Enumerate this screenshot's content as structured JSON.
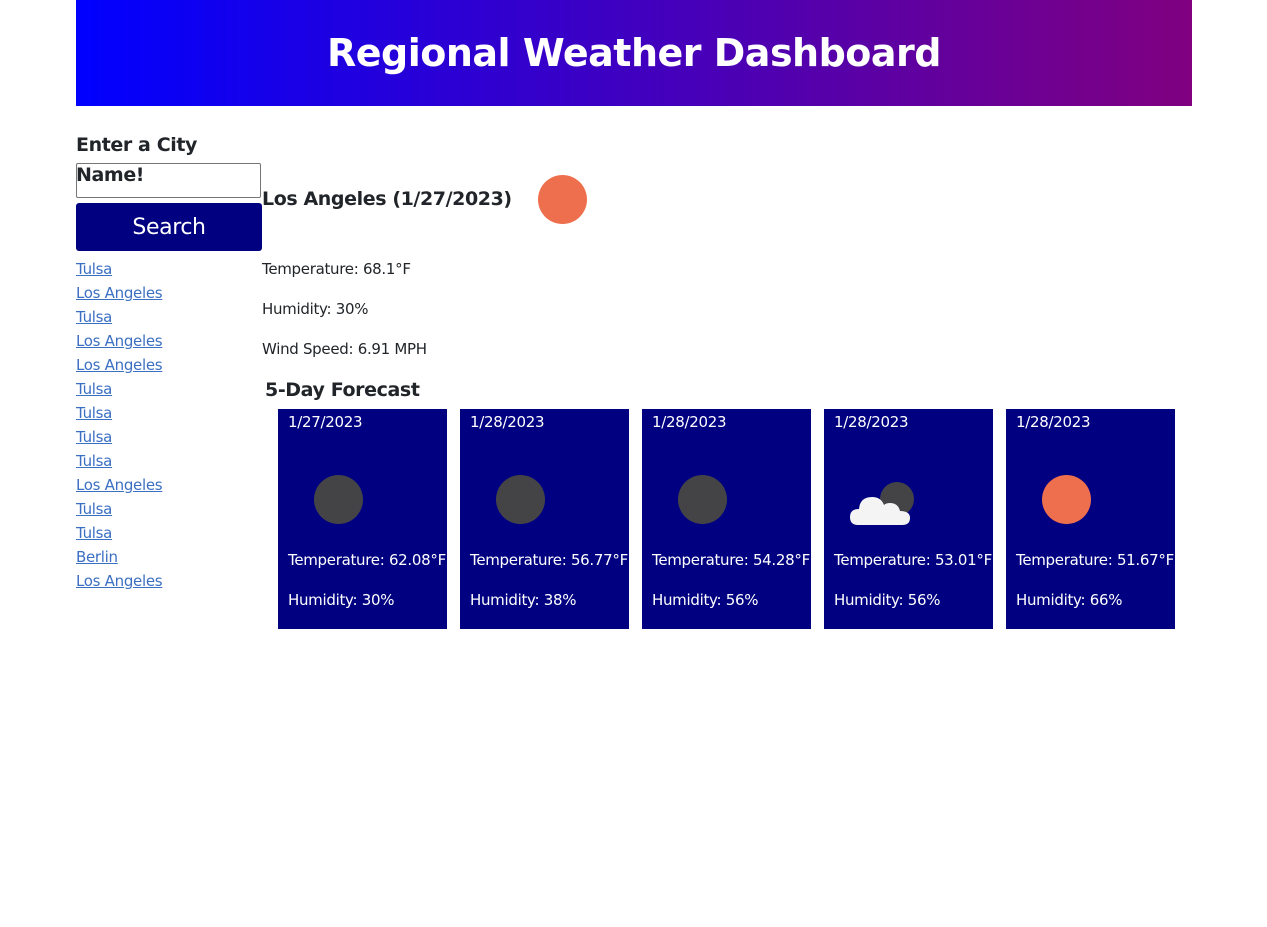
{
  "header": {
    "title": "Regional Weather Dashboard",
    "gradient_start": "#0000ff",
    "gradient_end": "#800080"
  },
  "search": {
    "label": "Enter a City Name!",
    "input_value": "",
    "button_label": "Search"
  },
  "history": [
    "Tulsa",
    "Los Angeles",
    "Tulsa",
    "Los Angeles",
    "Los Angeles",
    "Tulsa",
    "Tulsa",
    "Tulsa",
    "Tulsa",
    "Los Angeles",
    "Tulsa",
    "Tulsa",
    "Berlin",
    "Los Angeles"
  ],
  "current": {
    "title": "Los Angeles (1/27/2023)",
    "icon": "clear-day-icon",
    "temperature": "Temperature: 68.1°F",
    "humidity": "Humidity: 30%",
    "wind": "Wind Speed: 6.91 MPH"
  },
  "forecast": {
    "title": "5-Day Forecast",
    "card_color": "#000080",
    "days": [
      {
        "date": "1/27/2023",
        "icon": "clear-night-icon",
        "temperature": "Temperature: 62.08°F",
        "humidity": "Humidity: 30%"
      },
      {
        "date": "1/28/2023",
        "icon": "clear-night-icon",
        "temperature": "Temperature: 56.77°F",
        "humidity": "Humidity: 38%"
      },
      {
        "date": "1/28/2023",
        "icon": "clear-night-icon",
        "temperature": "Temperature: 54.28°F",
        "humidity": "Humidity: 56%"
      },
      {
        "date": "1/28/2023",
        "icon": "cloudy-night-icon",
        "temperature": "Temperature: 53.01°F",
        "humidity": "Humidity: 56%"
      },
      {
        "date": "1/28/2023",
        "icon": "clear-day-icon",
        "temperature": "Temperature: 51.67°F",
        "humidity": "Humidity: 66%"
      }
    ]
  },
  "colors": {
    "sun": "#ee6f4d",
    "moon": "#444447",
    "link": "#3b6fc4",
    "button": "#000080"
  }
}
